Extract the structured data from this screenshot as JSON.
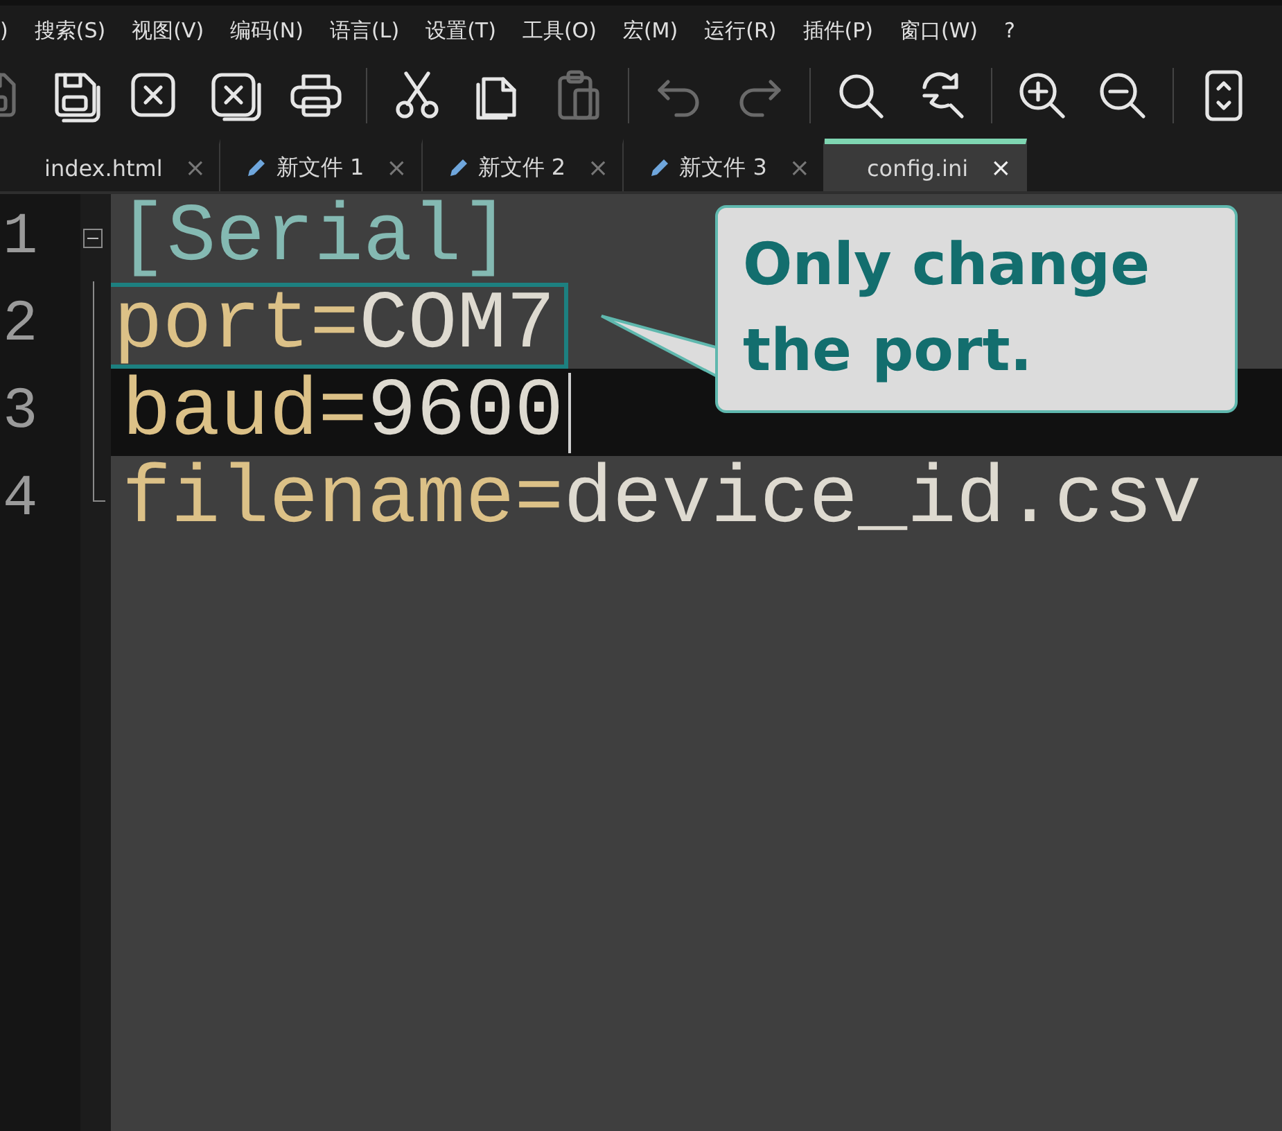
{
  "menu": [
    ")",
    "搜索(S)",
    "视图(V)",
    "编码(N)",
    "语言(L)",
    "设置(T)",
    "工具(O)",
    "宏(M)",
    "运行(R)",
    "插件(P)",
    "窗口(W)",
    "?"
  ],
  "toolbar": [
    [
      {
        "kind": "save",
        "disabled": true
      },
      {
        "kind": "save-all",
        "disabled": false
      },
      {
        "kind": "close",
        "disabled": false
      },
      {
        "kind": "close-all",
        "disabled": false
      },
      {
        "kind": "print",
        "disabled": false
      }
    ],
    [
      {
        "kind": "cut",
        "disabled": false
      },
      {
        "kind": "copy",
        "disabled": false
      },
      {
        "kind": "paste",
        "disabled": true
      }
    ],
    [
      {
        "kind": "undo",
        "disabled": true
      },
      {
        "kind": "redo",
        "disabled": true
      }
    ],
    [
      {
        "kind": "find",
        "disabled": false
      },
      {
        "kind": "replace",
        "disabled": false
      }
    ],
    [
      {
        "kind": "zoom-in",
        "disabled": false
      },
      {
        "kind": "zoom-out",
        "disabled": false
      }
    ],
    [
      {
        "kind": "sync",
        "disabled": false
      }
    ]
  ],
  "tabs": [
    {
      "label": "index.html",
      "modified": false,
      "selected": false
    },
    {
      "label": "新文件 1",
      "modified": true,
      "selected": false
    },
    {
      "label": "新文件 2",
      "modified": true,
      "selected": false
    },
    {
      "label": "新文件 3",
      "modified": true,
      "selected": false
    },
    {
      "label": "config.ini",
      "modified": false,
      "selected": true
    }
  ],
  "close_mark": "×",
  "editor": {
    "lines": [
      {
        "number": "1",
        "kind": "section",
        "text": "[Serial]",
        "expanded": true,
        "current": false,
        "highlighted": false,
        "caret": false
      },
      {
        "number": "2",
        "kind": "pair",
        "key": "port",
        "separator": "=",
        "value": "COM7",
        "current": false,
        "highlighted": true,
        "caret": false
      },
      {
        "number": "3",
        "kind": "pair",
        "key": "baud",
        "separator": "=",
        "value": "9600",
        "current": true,
        "highlighted": false,
        "caret": true
      },
      {
        "number": "4",
        "kind": "pair",
        "key": "filename",
        "separator": "=",
        "value": "device_id.csv",
        "current": false,
        "highlighted": false,
        "caret": false
      }
    ]
  },
  "callout": {
    "text": "Only change the port."
  }
}
